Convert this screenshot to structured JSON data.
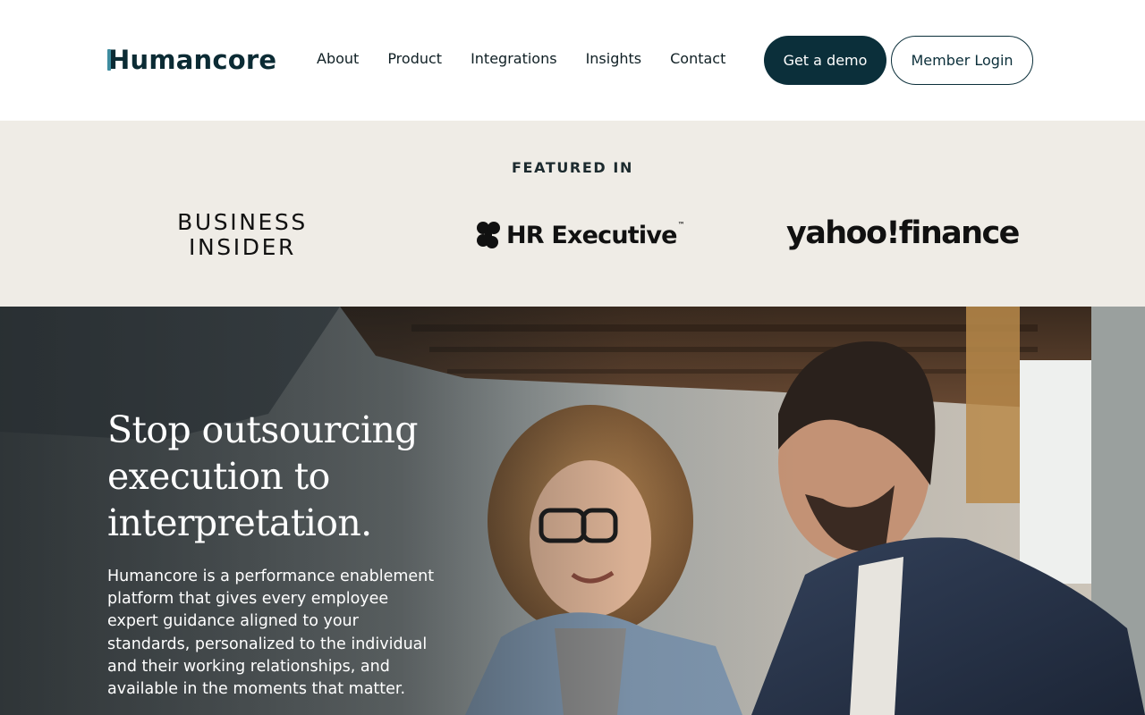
{
  "header": {
    "logo": "Humancore",
    "nav": [
      "About",
      "Product",
      "Integrations",
      "Insights",
      "Contact"
    ],
    "demo_button": "Get a demo",
    "login_button": "Member Login"
  },
  "featured": {
    "title": "FEATURED IN",
    "logos": {
      "business_insider": "BUSINESS INSIDER",
      "hr_executive": "HR Executive",
      "hr_executive_tm": "™",
      "yahoo_finance": "yahoo!finance"
    }
  },
  "hero": {
    "title": "Stop outsourcing execution to interpretation.",
    "body": "Humancore is a performance enablement platform that gives every employee expert guidance aligned to your standards, personalized to the individual and their working relationships, and available in the moments that matter."
  },
  "colors": {
    "brand_dark": "#0b2f3a",
    "logo_accent": "#3f8da0",
    "featured_bg": "#efece6"
  }
}
